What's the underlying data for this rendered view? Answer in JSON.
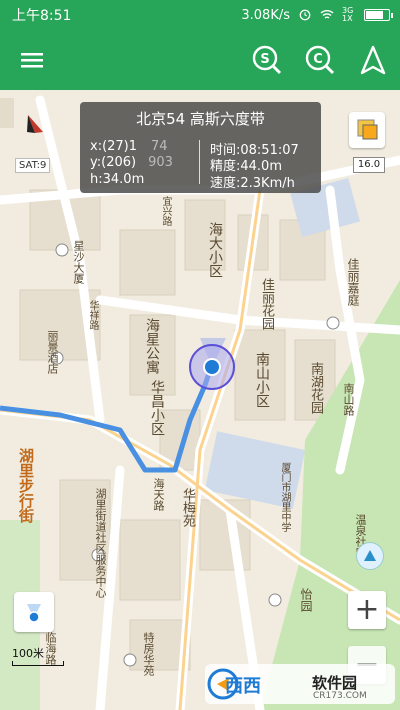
{
  "status_bar": {
    "time": "上午8:51",
    "network_speed": "3.08K/s",
    "network_type": "3G 1X"
  },
  "app_bar": {
    "menu_icon": "menu-icon",
    "icons": [
      "search-s-icon",
      "search-c-icon",
      "navigate-arrow-icon"
    ]
  },
  "info_panel": {
    "title": "北京54  高斯六度带",
    "x_label": "x:(27)1",
    "x_tail": "74",
    "y_label": "y:(206)",
    "y_tail": "903",
    "h": "h:34.0m",
    "time": "时间:08:51:07",
    "accuracy": "精度:44.0m",
    "speed": "速度:2.3Km/h"
  },
  "map_overlay": {
    "sat_count": "SAT:9",
    "zoom_level": "16.0",
    "scale": "100米",
    "zoom_in": "+",
    "zoom_out": "−"
  },
  "map_labels": {
    "l1": "海大小区",
    "l2": "佳丽花园",
    "l3": "佳丽嘉庭",
    "l4": "海星公寓",
    "l5": "华昌小区",
    "l6": "南山小区",
    "l7": "南湖花园",
    "l8": "星沙大厦",
    "l9": "湖里步行街",
    "l10": "湖里街道社区服务中心",
    "l11": "华梅苑",
    "l12": "海天路",
    "l13": "南山路",
    "l14": "厦门市湖里中学",
    "l15": "特房华苑",
    "l16": "临海路",
    "l17": "怡园",
    "l18": "温泉社区",
    "l19": "宜兴路",
    "l20": "丽景酒店",
    "l21": "华祥路"
  },
  "watermark": {
    "brand": "西西",
    "site": "软件园",
    "url": "CR173.COM"
  },
  "colors": {
    "primary": "#27a558",
    "route": "#4a90e2",
    "location": "#5b4fd6"
  }
}
